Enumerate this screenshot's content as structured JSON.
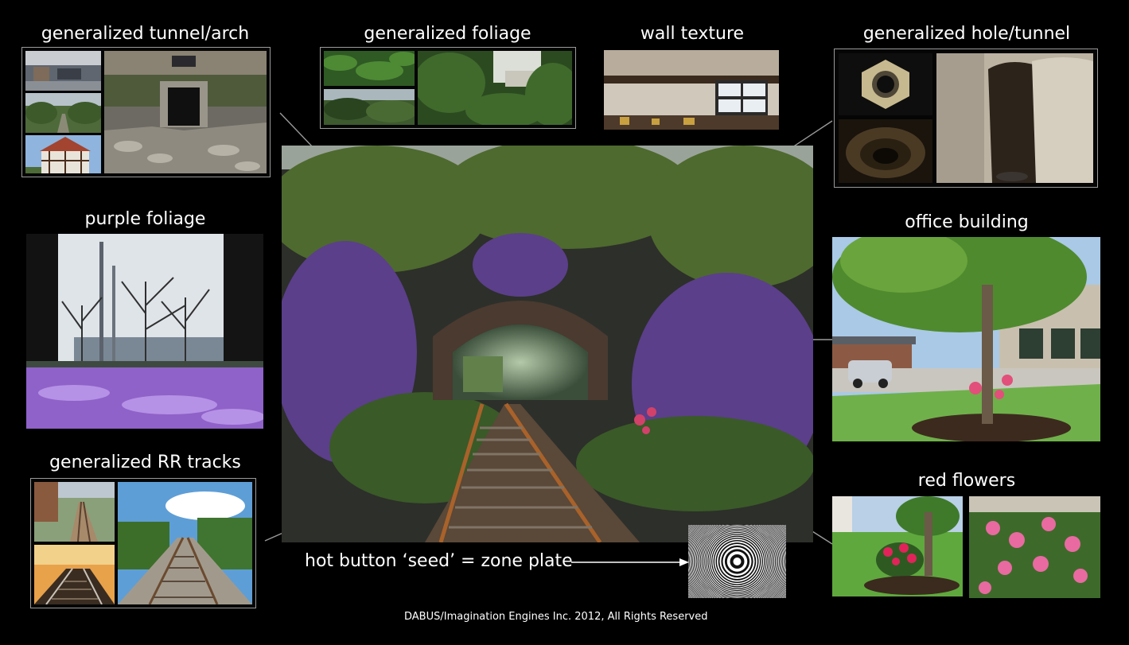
{
  "labels": {
    "tunnel_arch": "generalized tunnel/arch",
    "foliage": "generalized foliage",
    "wall_texture": "wall texture",
    "hole_tunnel": "generalized hole/tunnel",
    "purple_foliage": "purple foliage",
    "office_building": "office building",
    "rr_tracks": "generalized RR tracks",
    "red_flowers": "red flowers"
  },
  "caption": "hot button ‘seed’ = zone plate",
  "credit": "DABUS/Imagination Engines Inc. 2012, All Rights Reserved",
  "colors": {
    "background": "#000000",
    "text": "#ffffff",
    "frame_border": "#9a9a9a",
    "connector": "#9a9a9a"
  }
}
